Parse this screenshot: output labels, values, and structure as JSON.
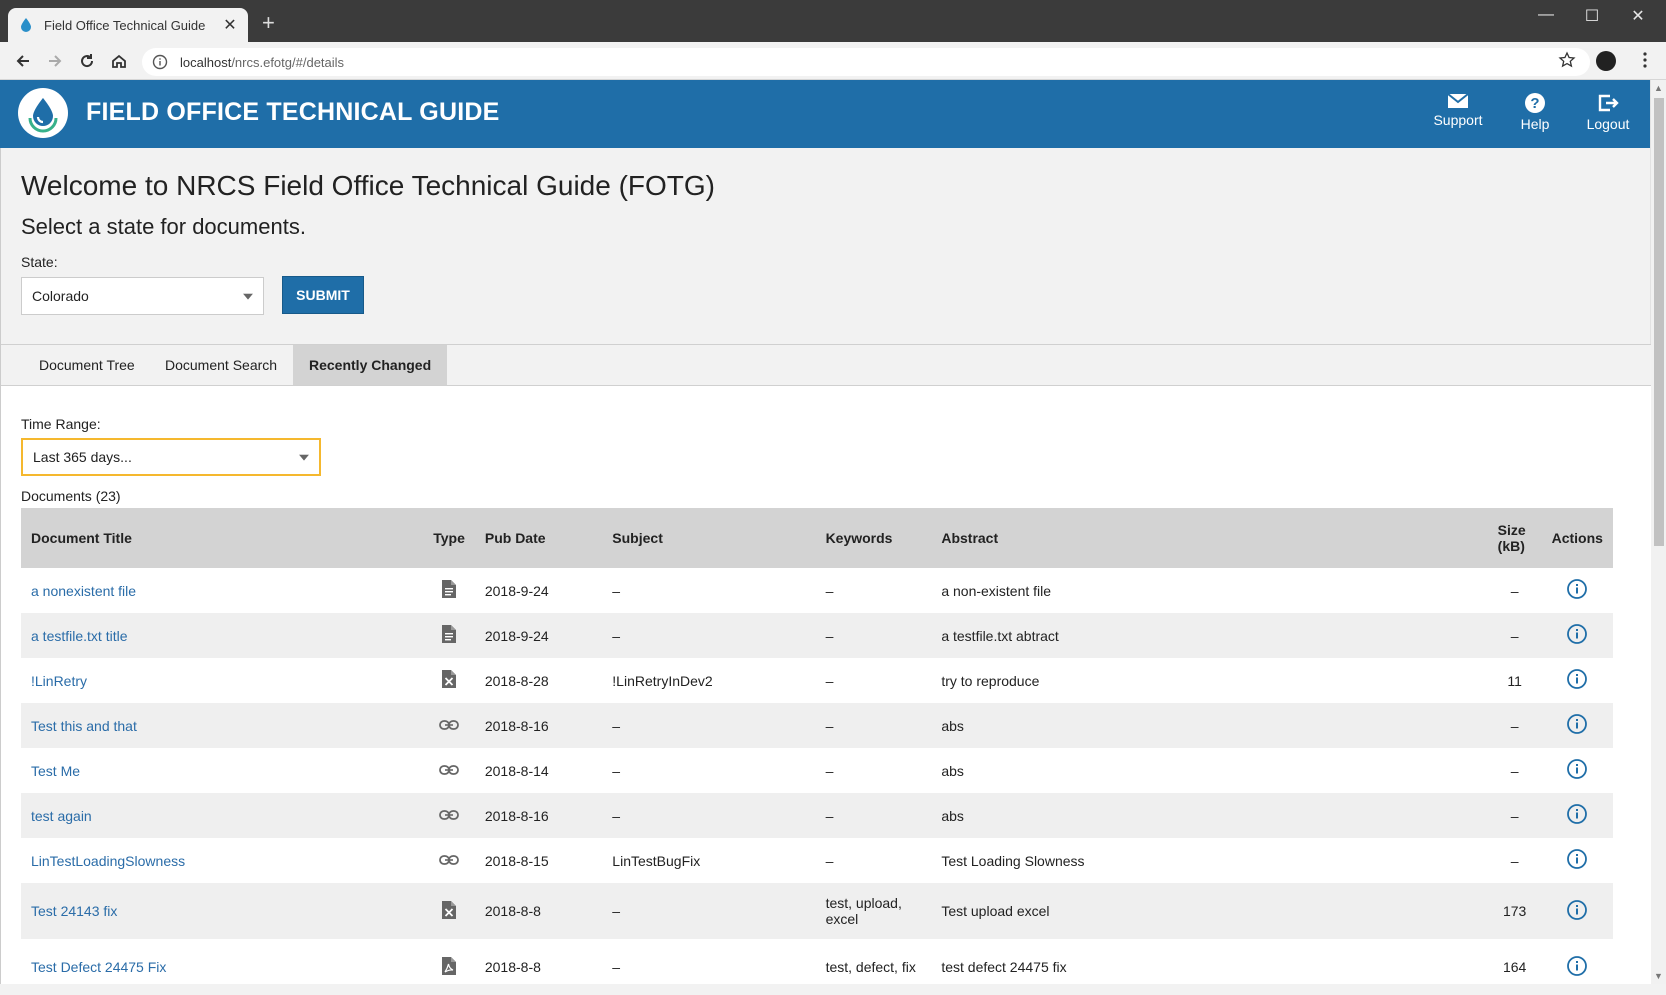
{
  "browser": {
    "tab_title": "Field Office Technical Guide",
    "url_host": "localhost",
    "url_path": "/nrcs.efotg/#/details"
  },
  "header": {
    "title": "FIELD OFFICE TECHNICAL GUIDE",
    "support": "Support",
    "help": "Help",
    "logout": "Logout",
    "brand_color": "#1f6ea8"
  },
  "intro": {
    "welcome": "Welcome to NRCS Field Office Technical Guide (FOTG)",
    "subtitle": "Select a state for documents.",
    "state_label": "State:",
    "state_value": "Colorado",
    "submit_label": "SUBMIT"
  },
  "tabs": [
    "Document Tree",
    "Document Search",
    "Recently Changed"
  ],
  "active_tab": "Recently Changed",
  "filter": {
    "time_label": "Time Range:",
    "time_value": "Last 365 days...",
    "docs_count": "Documents (23)"
  },
  "table": {
    "columns": {
      "title": "Document Title",
      "type": "Type",
      "pub_date": "Pub Date",
      "subject": "Subject",
      "keywords": "Keywords",
      "abstract": "Abstract",
      "size_line1": "Size",
      "size_line2": "(kB)",
      "actions": "Actions"
    },
    "rows": [
      {
        "title": "a nonexistent file",
        "type": "document-icon",
        "pub_date": "2018-9-24",
        "subject": "–",
        "keywords": "–",
        "abstract": "a non-existent file",
        "size": "–"
      },
      {
        "title": "a testfile.txt title",
        "type": "document-icon",
        "pub_date": "2018-9-24",
        "subject": "–",
        "keywords": "–",
        "abstract": "a testfile.txt abtract",
        "size": "–"
      },
      {
        "title": "!LinRetry",
        "type": "excel-icon",
        "pub_date": "2018-8-28",
        "subject": "!LinRetryInDev2",
        "keywords": "–",
        "abstract": "try to reproduce",
        "size": "11"
      },
      {
        "title": "Test this and that",
        "type": "link-icon",
        "pub_date": "2018-8-16",
        "subject": "–",
        "keywords": "–",
        "abstract": "abs",
        "size": "–"
      },
      {
        "title": "Test Me",
        "type": "link-icon",
        "pub_date": "2018-8-14",
        "subject": "–",
        "keywords": "–",
        "abstract": "abs",
        "size": "–"
      },
      {
        "title": "test again",
        "type": "link-icon",
        "pub_date": "2018-8-16",
        "subject": "–",
        "keywords": "–",
        "abstract": "abs",
        "size": "–"
      },
      {
        "title": "LinTestLoadingSlowness",
        "type": "link-icon",
        "pub_date": "2018-8-15",
        "subject": "LinTestBugFix",
        "keywords": "–",
        "abstract": "Test Loading Slowness",
        "size": "–"
      },
      {
        "title": "Test 24143 fix",
        "type": "excel-icon",
        "pub_date": "2018-8-8",
        "subject": "–",
        "keywords": "test, upload, excel",
        "abstract": "Test upload excel",
        "size": "173"
      },
      {
        "title": "Test Defect 24475 Fix",
        "type": "pdf-icon",
        "pub_date": "2018-8-8",
        "subject": "–",
        "keywords": "test, defect, fix",
        "abstract": "test defect 24475 fix",
        "size": "164"
      }
    ]
  }
}
